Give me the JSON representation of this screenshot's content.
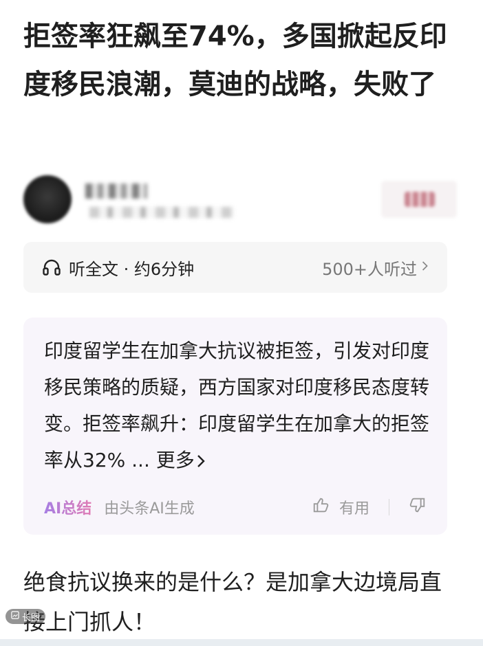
{
  "article": {
    "title": "拒签率狂飙至74%，多国掀起反印度移民浪潮，莫迪的战略，失败了",
    "body_first_paragraph": "绝食抗议换来的是什么？是加拿大边境局直接上门抓人！"
  },
  "listen": {
    "label": "听全文 · 约6分钟",
    "listeners": "500+人听过",
    "icon": "headphone-icon",
    "chevron_icon": "chevron-right-icon"
  },
  "ai_summary": {
    "text": "印度留学生在加拿大抗议被拒签，引发对印度移民策略的质疑，西方国家对印度移民态度转变。拒签率飙升：印度留学生在加拿大的拒签率从32%",
    "more_label": "... 更多",
    "badge": "AI总结",
    "source": "由头条AI生成",
    "useful_label": "有用",
    "like_icon": "thumbs-up-icon",
    "dislike_icon": "thumbs-down-icon"
  },
  "overlay": {
    "badge_label": "长图",
    "badge_icon": "image-icon"
  },
  "colors": {
    "ai_gradient_start": "#a77ee3",
    "ai_gradient_end": "#e07bb4",
    "card_bg": "#f8f5fb"
  }
}
